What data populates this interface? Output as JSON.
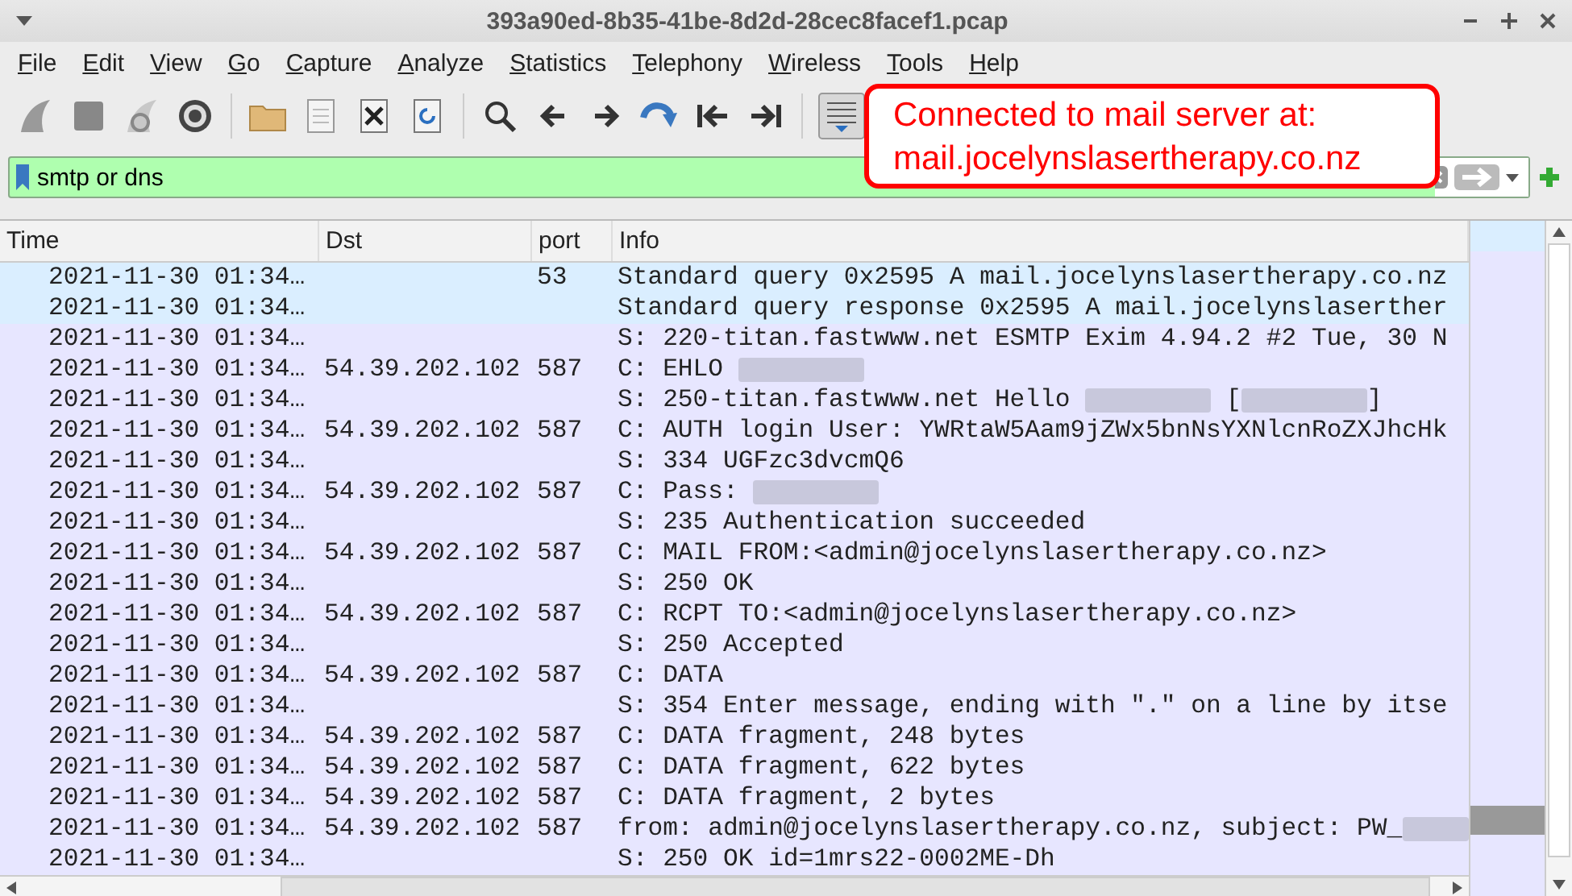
{
  "window": {
    "title": "393a90ed-8b35-41be-8d2d-28cec8facef1.pcap"
  },
  "menu": [
    "File",
    "Edit",
    "View",
    "Go",
    "Capture",
    "Analyze",
    "Statistics",
    "Telephony",
    "Wireless",
    "Tools",
    "Help"
  ],
  "filter": {
    "value": "smtp or dns"
  },
  "callout": {
    "lines": [
      "Connected to mail server at:",
      "mail.jocelynslasertherapy.co.nz"
    ]
  },
  "table": {
    "columns": [
      "Time",
      "Dst",
      "port",
      "Info"
    ],
    "rows": [
      {
        "time": "2021-11-30 01:34…",
        "port": "53",
        "color": "#daeeff",
        "info": [
          {
            "kind": "text",
            "text": "Standard query 0x2595 A mail.jocelynslasertherapy.co.nz"
          }
        ]
      },
      {
        "time": "2021-11-30 01:34…",
        "color": "#daeeff",
        "info": [
          {
            "kind": "text",
            "text": "Standard query response 0x2595 A mail.jocelynslaserther"
          }
        ]
      },
      {
        "time": "2021-11-30 01:34…",
        "color": "#e7e6ff",
        "info": [
          {
            "kind": "text",
            "text": "S: 220-titan.fastwww.net ESMTP Exim 4.94.2 #2 Tue, 30 N"
          }
        ]
      },
      {
        "time": "2021-11-30 01:34…",
        "dst": "54.39.202.102",
        "port": "587",
        "color": "#e7e6ff",
        "info": [
          {
            "kind": "text",
            "text": "C: EHLO "
          },
          {
            "kind": "redacted"
          }
        ]
      },
      {
        "time": "2021-11-30 01:34…",
        "color": "#e7e6ff",
        "info": [
          {
            "kind": "text",
            "text": "S: 250-titan.fastwww.net Hello "
          },
          {
            "kind": "redacted"
          },
          {
            "kind": "text",
            "text": " ["
          },
          {
            "kind": "redacted"
          },
          {
            "kind": "text",
            "text": "]"
          }
        ]
      },
      {
        "time": "2021-11-30 01:34…",
        "dst": "54.39.202.102",
        "port": "587",
        "color": "#e7e6ff",
        "info": [
          {
            "kind": "text",
            "text": "C: AUTH login User: YWRtaW5Aam9jZWx5bnNsYXNlcnRoZXJhcHk"
          }
        ]
      },
      {
        "time": "2021-11-30 01:34…",
        "color": "#e7e6ff",
        "info": [
          {
            "kind": "text",
            "text": "S: 334 UGFzc3dvcmQ6"
          }
        ]
      },
      {
        "time": "2021-11-30 01:34…",
        "dst": "54.39.202.102",
        "port": "587",
        "color": "#e7e6ff",
        "info": [
          {
            "kind": "text",
            "text": "C: Pass: "
          },
          {
            "kind": "redacted"
          }
        ]
      },
      {
        "time": "2021-11-30 01:34…",
        "color": "#e7e6ff",
        "info": [
          {
            "kind": "text",
            "text": "S: 235 Authentication succeeded"
          }
        ]
      },
      {
        "time": "2021-11-30 01:34…",
        "dst": "54.39.202.102",
        "port": "587",
        "color": "#e7e6ff",
        "info": [
          {
            "kind": "text",
            "text": "C: MAIL FROM:<admin@jocelynslasertherapy.co.nz>"
          }
        ]
      },
      {
        "time": "2021-11-30 01:34…",
        "color": "#e7e6ff",
        "info": [
          {
            "kind": "text",
            "text": "S: 250 OK"
          }
        ]
      },
      {
        "time": "2021-11-30 01:34…",
        "dst": "54.39.202.102",
        "port": "587",
        "color": "#e7e6ff",
        "info": [
          {
            "kind": "text",
            "text": "C: RCPT TO:<admin@jocelynslasertherapy.co.nz>"
          }
        ]
      },
      {
        "time": "2021-11-30 01:34…",
        "color": "#e7e6ff",
        "info": [
          {
            "kind": "text",
            "text": "S: 250 Accepted"
          }
        ]
      },
      {
        "time": "2021-11-30 01:34…",
        "dst": "54.39.202.102",
        "port": "587",
        "color": "#e7e6ff",
        "info": [
          {
            "kind": "text",
            "text": "C: DATA"
          }
        ]
      },
      {
        "time": "2021-11-30 01:34…",
        "color": "#e7e6ff",
        "info": [
          {
            "kind": "text",
            "text": "S: 354 Enter message, ending with \".\" on a line by itse"
          }
        ]
      },
      {
        "time": "2021-11-30 01:34…",
        "dst": "54.39.202.102",
        "port": "587",
        "color": "#e7e6ff",
        "info": [
          {
            "kind": "text",
            "text": "C: DATA fragment, 248 bytes"
          }
        ]
      },
      {
        "time": "2021-11-30 01:34…",
        "dst": "54.39.202.102",
        "port": "587",
        "color": "#e7e6ff",
        "info": [
          {
            "kind": "text",
            "text": "C: DATA fragment, 622 bytes"
          }
        ]
      },
      {
        "time": "2021-11-30 01:34…",
        "dst": "54.39.202.102",
        "port": "587",
        "color": "#e7e6ff",
        "info": [
          {
            "kind": "text",
            "text": "C: DATA fragment, 2 bytes"
          }
        ]
      },
      {
        "time": "2021-11-30 01:34…",
        "dst": "54.39.202.102",
        "port": "587",
        "color": "#e7e6ff",
        "info": [
          {
            "kind": "text",
            "text": "from: admin@jocelynslasertherapy.co.nz, subject: PW_"
          },
          {
            "kind": "redacted"
          }
        ]
      },
      {
        "time": "2021-11-30 01:34…",
        "color": "#e7e6ff",
        "info": [
          {
            "kind": "text",
            "text": "S: 250 OK id=1mrs22-0002ME-Dh"
          }
        ]
      }
    ]
  }
}
